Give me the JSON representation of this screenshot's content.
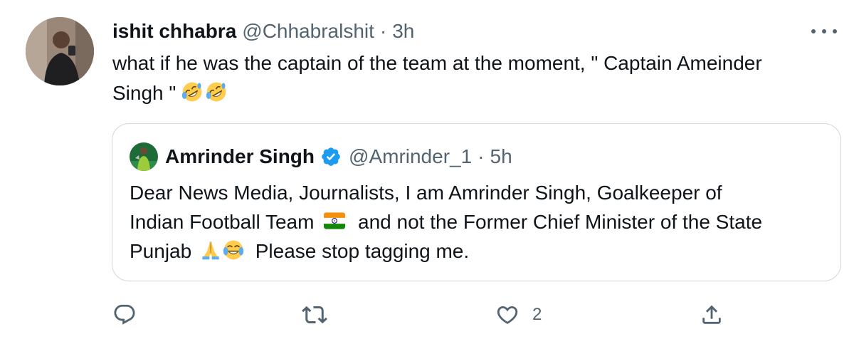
{
  "tweet": {
    "author_name": "ishit chhabra",
    "author_handle": "@Chhabralshit",
    "separator": "·",
    "time": "3h",
    "text_line1": "what if he was the captain of the team at the moment, \" Captain Ameinder",
    "text_line2": "Singh \"",
    "emojis": [
      "rolling-on-floor-laughing-emoji",
      "rolling-on-floor-laughing-emoji"
    ]
  },
  "quoted": {
    "author_name": "Amrinder Singh",
    "verified": true,
    "author_handle": "@Amrinder_1",
    "separator": "·",
    "time": "5h",
    "line1": "Dear News Media, Journalists, I am Amrinder Singh, Goalkeeper of",
    "line2_a": "Indian Football Team",
    "line2_b": "and not the Former Chief Minister of the State",
    "line3_a": "Punjab",
    "line3_b": "Please stop tagging me.",
    "emojis": [
      "india-flag-emoji",
      "folded-hands-emoji",
      "face-with-tears-of-joy-emoji"
    ]
  },
  "actions": {
    "reply_icon": "reply-icon",
    "retweet_icon": "retweet-icon",
    "like_icon": "like-icon",
    "like_count": "2",
    "share_icon": "share-icon"
  },
  "colors": {
    "text": "#0f1419",
    "secondary": "#536471",
    "border": "#cfd9de",
    "verified": "#1d9bf0"
  }
}
